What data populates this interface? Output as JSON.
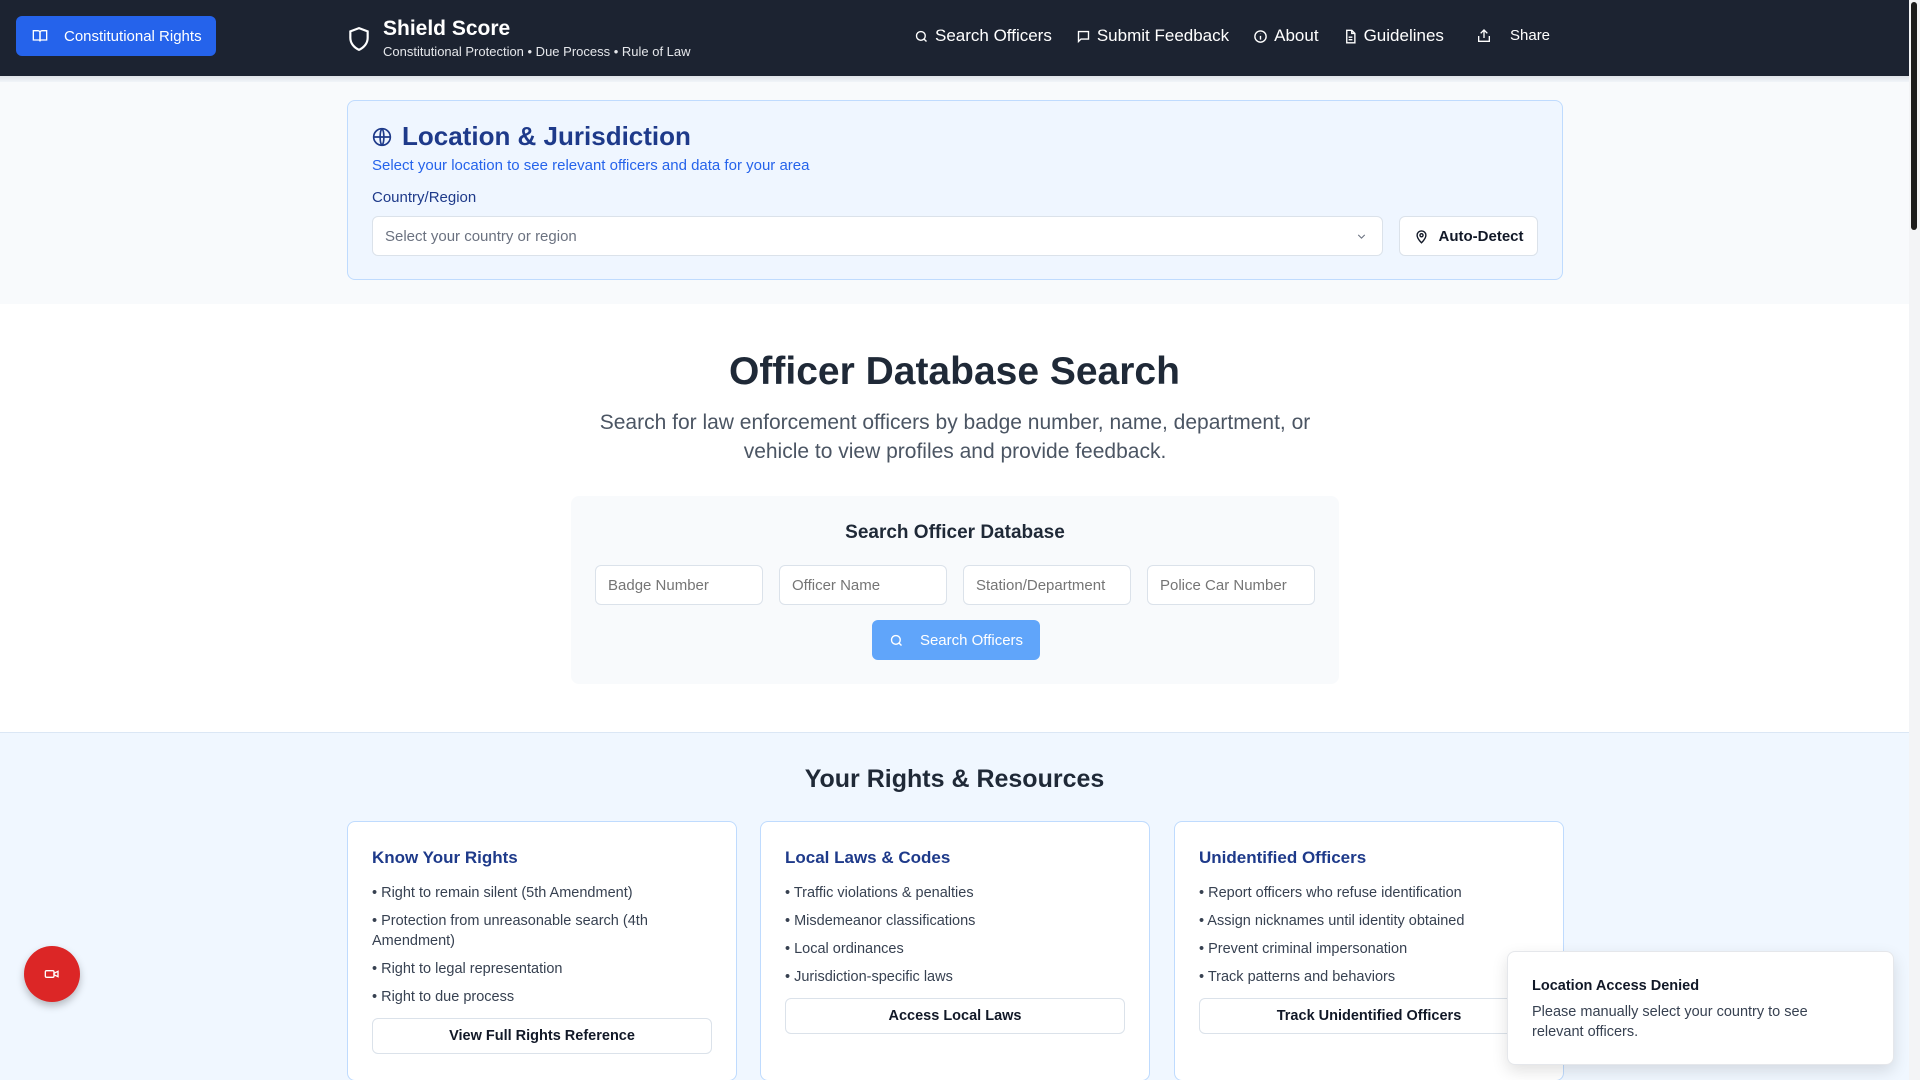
{
  "header": {
    "rights_button": "Constitutional Rights",
    "brand_title": "Shield Score",
    "brand_subtitle": "Constitutional Protection • Due Process • Rule of Law",
    "nav": [
      "Search Officers",
      "Submit Feedback",
      "About",
      "Guidelines"
    ],
    "share": "Share"
  },
  "location": {
    "title": "Location & Jurisdiction",
    "description": "Select your location to see relevant officers and data for your area",
    "country_label": "Country/Region",
    "country_placeholder": "Select your country or region",
    "auto_detect": "Auto-Detect"
  },
  "search": {
    "title": "Officer Database Search",
    "description": "Search for law enforcement officers by badge number, name, department, or vehicle to view profiles and provide feedback.",
    "card_title": "Search Officer Database",
    "badge_placeholder": "Badge Number",
    "name_placeholder": "Officer Name",
    "station_placeholder": "Station/Department",
    "car_placeholder": "Police Car Number",
    "button": "Search Officers"
  },
  "resources": {
    "title": "Your Rights & Resources",
    "cards": [
      {
        "title": "Know Your Rights",
        "items": [
          "• Right to remain silent (5th Amendment)",
          "• Protection from unreasonable search (4th Amendment)",
          "• Right to legal representation",
          "• Right to due process"
        ],
        "button": "View Full Rights Reference"
      },
      {
        "title": "Local Laws & Codes",
        "items": [
          "• Traffic violations & penalties",
          "• Misdemeanor classifications",
          "• Local ordinances",
          "• Jurisdiction-specific laws"
        ],
        "button": "Access Local Laws"
      },
      {
        "title": "Unidentified Officers",
        "items": [
          "• Report officers who refuse identification",
          "• Assign nicknames until identity obtained",
          "• Prevent criminal impersonation",
          "• Track patterns and behaviors"
        ],
        "button": "Track Unidentified Officers"
      }
    ]
  },
  "toast": {
    "title": "Location Access Denied",
    "message": "Please manually select your country to see relevant officers."
  },
  "colors": {
    "header_bg": "#1c2331",
    "accent": "#2563eb",
    "record": "#dc2626"
  }
}
